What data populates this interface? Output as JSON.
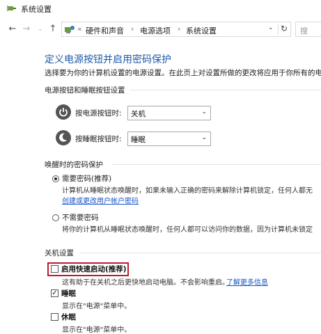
{
  "window": {
    "title": "系统设置"
  },
  "nav": {
    "back": "←",
    "forward": "→",
    "history": "⌄",
    "up": "↑",
    "overflow": "«",
    "crumbs": [
      "硬件和声音",
      "电源选项",
      "系统设置"
    ],
    "separator": "›",
    "dropdown": "⌄",
    "refresh": "↻",
    "search_placeholder": "搜"
  },
  "page": {
    "title": "定义电源按钮并启用密码保护",
    "description": "选择要为你的计算机设置的电源设置。在此页上对设置所做的更改将应用于你所有的电"
  },
  "buttons_section": {
    "header": "电源按钮和睡眠按钮设置",
    "rows": [
      {
        "label": "按电源按钮时:",
        "value": "关机"
      },
      {
        "label": "按睡眠按钮时:",
        "value": "睡眠"
      }
    ],
    "arrow": "⌄"
  },
  "wake_section": {
    "header": "唤醒时的密码保护",
    "options": [
      {
        "label": "需要密码(推荐)",
        "desc": "计算机从睡眠状态唤醒时，如果未输入正确的密码来解除计算机锁定，任何人都无",
        "link": "创建或更改用户帐户密码",
        "selected": true
      },
      {
        "label": "不需要密码",
        "desc": "将你的计算机从睡眠状态唤醒时，任何人都可以访问你的数据，因为计算机未锁定",
        "selected": false
      }
    ]
  },
  "shutdown_section": {
    "header": "关机设置",
    "items": [
      {
        "label": "启用快速启动(推荐)",
        "checked": false,
        "check_mark": "",
        "desc": "这有助于在关机之后更快地启动电脑。不会影响重启。",
        "link": "了解更多信息"
      },
      {
        "label": "睡眠",
        "checked": true,
        "check_mark": "✓",
        "desc": "显示在\"电源\"菜单中。"
      },
      {
        "label": "休眠",
        "checked": false,
        "check_mark": "",
        "desc": "显示在\"电源\"菜单中。"
      }
    ]
  },
  "colors": {
    "title_blue": "#1c5aa6",
    "link_blue": "#1a56c4",
    "highlight_red": "#c0192a"
  }
}
